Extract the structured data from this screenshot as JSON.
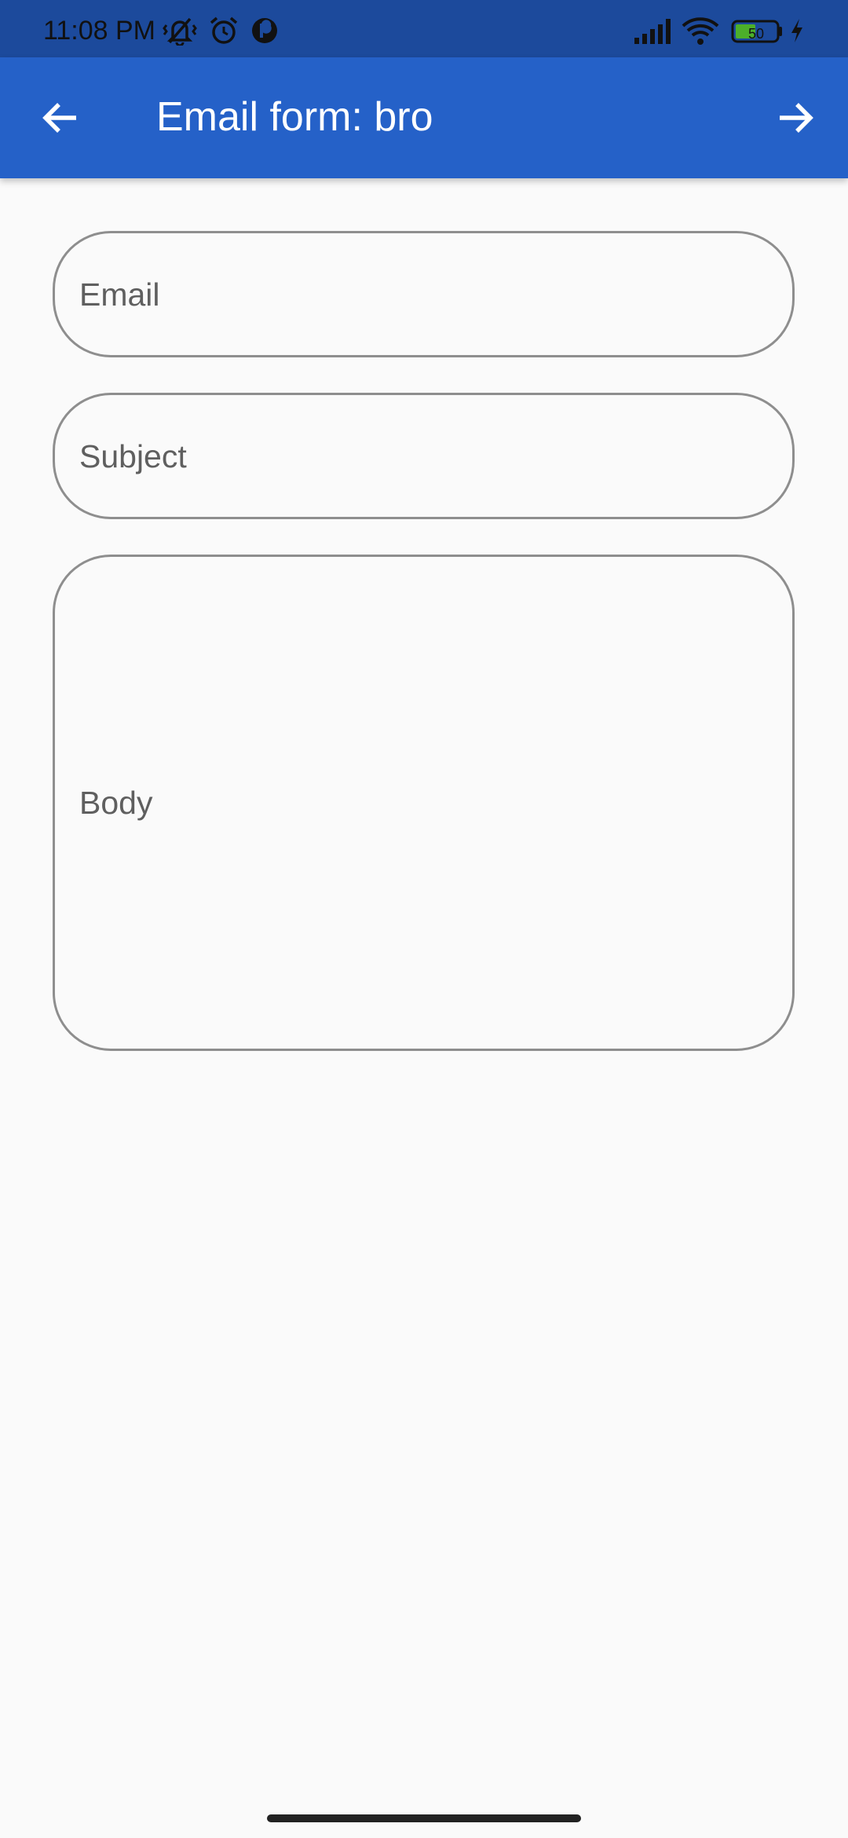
{
  "status_bar": {
    "time": "11:08 PM",
    "icons": [
      "vibrate-off-icon",
      "alarm-icon",
      "app-notification-icon",
      "signal-icon",
      "wifi-icon",
      "battery-charging-icon",
      "charging-bolt-icon"
    ],
    "battery_level": "50",
    "background_color": "#1c4a9c"
  },
  "app_bar": {
    "title": "Email form: bro",
    "back_icon": "arrow-back-icon",
    "forward_icon": "arrow-forward-icon",
    "background_color": "#2561c8"
  },
  "form": {
    "email": {
      "placeholder": "Email",
      "value": ""
    },
    "subject": {
      "placeholder": "Subject",
      "value": ""
    },
    "body": {
      "placeholder": "Body",
      "value": ""
    }
  }
}
